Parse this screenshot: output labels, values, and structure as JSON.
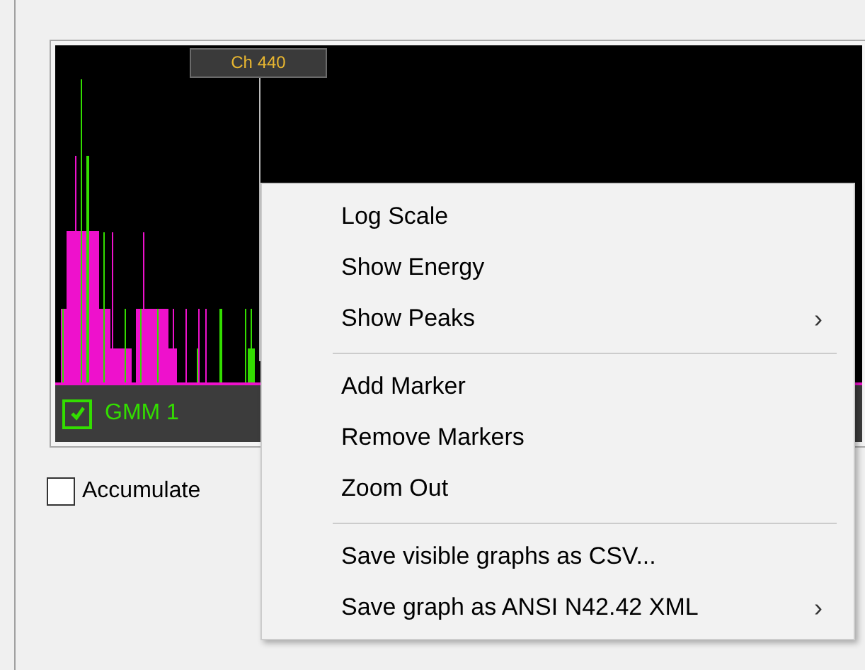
{
  "plot": {
    "marker_label": "Ch 440",
    "legend": [
      {
        "label": "GMM 1",
        "checked": true,
        "color": "#33dd00"
      }
    ]
  },
  "accumulate": {
    "label": "Accumulate",
    "checked": false
  },
  "context_menu": {
    "items": [
      {
        "kind": "item",
        "label": "Log Scale"
      },
      {
        "kind": "item",
        "label": "Show Energy"
      },
      {
        "kind": "item",
        "label": "Show Peaks",
        "submenu_arrow": "›"
      },
      {
        "kind": "separator"
      },
      {
        "kind": "item",
        "label": "Add Marker"
      },
      {
        "kind": "item",
        "label": "Remove Markers"
      },
      {
        "kind": "item",
        "label": "Zoom Out"
      },
      {
        "kind": "separator"
      },
      {
        "kind": "item",
        "label": "Save visible graphs as CSV..."
      },
      {
        "kind": "item",
        "label": "Save graph as ANSI N42.42 XML",
        "submenu_arrow": "›"
      }
    ]
  }
}
